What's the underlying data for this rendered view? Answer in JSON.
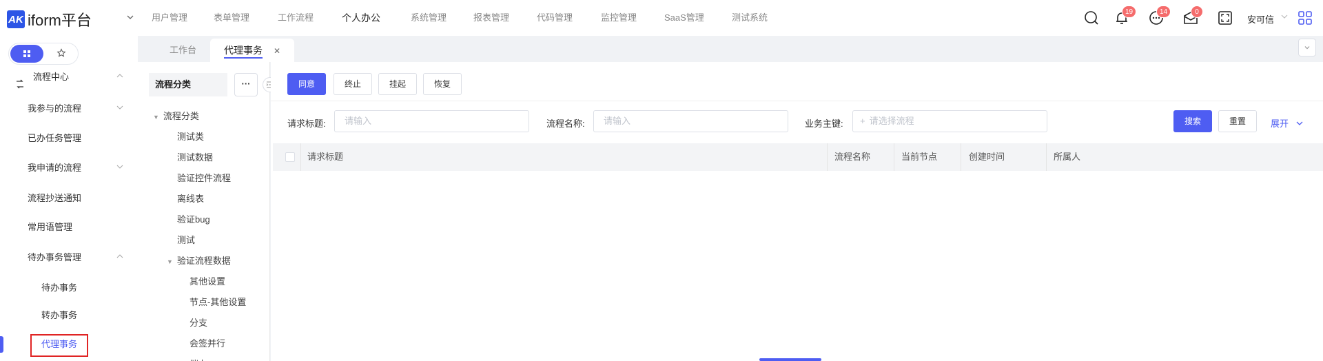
{
  "app": {
    "logo_mark": "AK",
    "logo_text": "iform平台"
  },
  "nav": {
    "items": [
      "用户管理",
      "表单管理",
      "工作流程",
      "个人办公",
      "系统管理",
      "报表管理",
      "代码管理",
      "监控管理",
      "SaaS管理",
      "测试系统"
    ],
    "active_index": 3
  },
  "topbar": {
    "notifications_badge": "19",
    "messages_badge": "14",
    "mail_badge": "0",
    "user_name": "安可信"
  },
  "sidebar": {
    "items": [
      {
        "label": "流程中心",
        "type": "group",
        "expanded": true
      },
      {
        "label": "我参与的流程",
        "type": "submenu"
      },
      {
        "label": "已办任务管理",
        "type": "item"
      },
      {
        "label": "我申请的流程",
        "type": "submenu"
      },
      {
        "label": "流程抄送通知",
        "type": "item"
      },
      {
        "label": "常用语管理",
        "type": "item"
      },
      {
        "label": "待办事务管理",
        "type": "submenu",
        "expanded": true
      },
      {
        "label": "待办事务",
        "type": "subitem"
      },
      {
        "label": "转办事务",
        "type": "subitem"
      },
      {
        "label": "代理事务",
        "type": "subitem",
        "active": true
      }
    ]
  },
  "tabs": [
    {
      "label": "工作台"
    },
    {
      "label": "代理事务",
      "active": true
    }
  ],
  "tree": {
    "title": "流程分类",
    "more_label": "···",
    "nodes": [
      {
        "label": "流程分类",
        "level": 0,
        "expanded": true
      },
      {
        "label": "测试类",
        "level": 1
      },
      {
        "label": "测试数据",
        "level": 1
      },
      {
        "label": "验证控件流程",
        "level": 1
      },
      {
        "label": "离线表",
        "level": 1
      },
      {
        "label": "验证bug",
        "level": 1
      },
      {
        "label": "测试",
        "level": 1
      },
      {
        "label": "验证流程数据",
        "level": 1,
        "expanded": true
      },
      {
        "label": "其他设置",
        "level": 2
      },
      {
        "label": "节点-其他设置",
        "level": 2
      },
      {
        "label": "分支",
        "level": 2
      },
      {
        "label": "会签并行",
        "level": 2
      },
      {
        "label": "催办",
        "level": 2
      }
    ]
  },
  "toolbar": {
    "agree": "同意",
    "terminate": "终止",
    "suspend": "挂起",
    "restore": "恢复"
  },
  "filters": {
    "title_label": "请求标题:",
    "title_placeholder": "请输入",
    "process_label": "流程名称:",
    "process_placeholder": "请输入",
    "business_label": "业务主键:",
    "business_placeholder": "请选择流程",
    "search": "搜索",
    "reset": "重置",
    "expand": "展开"
  },
  "table": {
    "columns": [
      "请求标题",
      "流程名称",
      "当前节点",
      "创建时间",
      "所属人"
    ],
    "rows": []
  },
  "colors": {
    "primary": "#4e5df2",
    "badge": "#f56c6c",
    "highlight_box": "#e02424"
  }
}
